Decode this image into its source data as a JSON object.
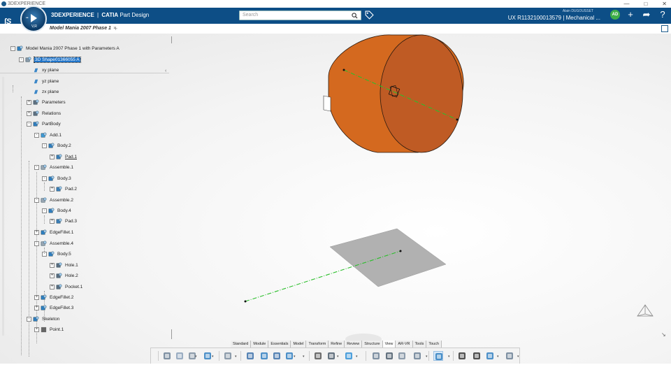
{
  "window": {
    "title": "3DEXPERIENCE",
    "controls": [
      "—",
      "□",
      "✕"
    ]
  },
  "header": {
    "brand_bold": "3D",
    "brand_rest": "EXPERIENCE",
    "separator": "|",
    "product": "CATIA",
    "app": "Part Design",
    "compass_version": "V,R",
    "search_placeholder": "Search",
    "user_name": "Alain DUGOUSSET",
    "project_label": "UX R1132100013579 | Mechanical ...",
    "avatar_text": "AD",
    "accent_color": "#0d4e86"
  },
  "tab": {
    "label": "Model Mania 2007 Phase 1",
    "close": "×",
    "add": "+"
  },
  "tree": [
    {
      "label": "Model Mania 2007 Phase 1 with Parameters A",
      "icon": "product-icon"
    },
    {
      "label": "3D Shape01366055 A",
      "icon": "shape-icon"
    },
    {
      "label": "xy plane",
      "icon": "plane-icon"
    },
    {
      "label": "yz plane",
      "icon": "plane-icon"
    },
    {
      "label": "zx plane",
      "icon": "plane-icon"
    },
    {
      "label": "Parameters",
      "icon": "parameters-icon"
    },
    {
      "label": "Relations",
      "icon": "relations-icon"
    },
    {
      "label": "PartBody",
      "icon": "body-icon"
    },
    {
      "label": "Add.1",
      "icon": "add-icon"
    },
    {
      "label": "Body.2",
      "icon": "body-icon"
    },
    {
      "label": "Pad.1",
      "icon": "pad-icon"
    },
    {
      "label": "Assemble.1",
      "icon": "assemble-icon"
    },
    {
      "label": "Body.3",
      "icon": "body-icon"
    },
    {
      "label": "Pad.2",
      "icon": "pad-icon"
    },
    {
      "label": "Assemble.2",
      "icon": "assemble-icon"
    },
    {
      "label": "Body.4",
      "icon": "body-icon"
    },
    {
      "label": "Pad.3",
      "icon": "pad-icon"
    },
    {
      "label": "EdgeFillet.1",
      "icon": "fillet-icon"
    },
    {
      "label": "Assemble.4",
      "icon": "assemble-icon"
    },
    {
      "label": "Body.5",
      "icon": "body-icon"
    },
    {
      "label": "Hole.1",
      "icon": "hole-icon"
    },
    {
      "label": "Hole.2",
      "icon": "hole-icon"
    },
    {
      "label": "Pocket.1",
      "icon": "pocket-icon"
    },
    {
      "label": "EdgeFillet.2",
      "icon": "fillet-icon"
    },
    {
      "label": "EdgeFillet.3",
      "icon": "fillet-icon"
    },
    {
      "label": "Skeleton",
      "icon": "skeleton-icon"
    },
    {
      "label": "Point.1",
      "icon": "point-icon"
    }
  ],
  "workshop_tabs": [
    "Standard",
    "Module",
    "Essentials",
    "Model",
    "Transform",
    "Refine",
    "Review",
    "Structure",
    "View",
    "AR-VR",
    "Tools",
    "Touch"
  ],
  "active_workshop_tab": "View",
  "action_bar_icons": [
    "cut-icon",
    "copy-icon",
    "paste-icon",
    "undo-icon",
    "update-icon",
    "zoom-fit-icon",
    "pan-icon",
    "rotate-icon",
    "zoom-icon",
    "capture-icon",
    "fly-icon",
    "cube-view-icon",
    "render-icon",
    "material-icon",
    "shading-icon",
    "compass-icon",
    "view-selection-icon",
    "hide-show-icon",
    "swap-visible-icon",
    "display-icon",
    "layout-icon"
  ],
  "colors": {
    "cylinder": "#d4691f",
    "cylinder_face": "#bf5b24",
    "plane": "#b1b1b1",
    "axis": "#2bbf2b",
    "selection": "#1e73c8"
  }
}
